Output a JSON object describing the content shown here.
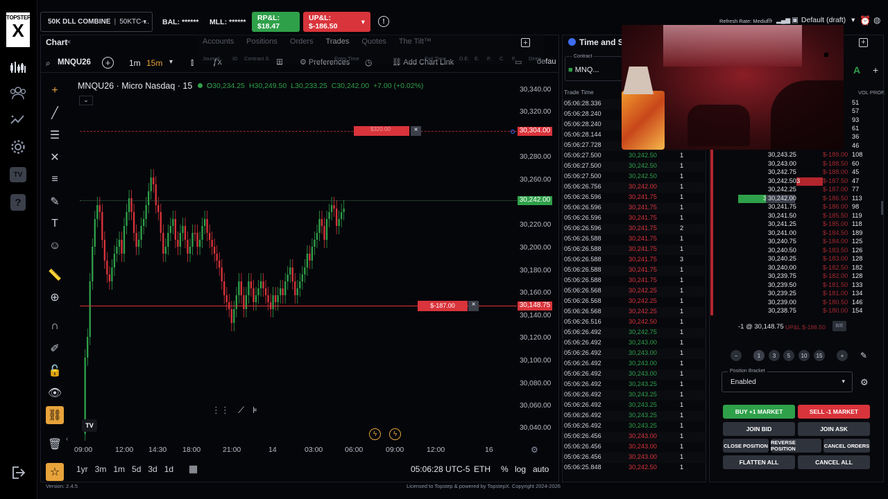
{
  "app": {
    "logo_top": "TOPSTEP",
    "logo_mark": "X",
    "version": "Version: 2.4.5",
    "license": "Licensed to Topstep & powered by TopstepX. Copyright 2024-2026"
  },
  "topbar": {
    "account_name": "50K DLL COMBINE",
    "account_id": "50KTC-...",
    "bal": "BAL: ******",
    "mll": "MLL: ******",
    "rpl": "RP&L: $18.47",
    "upl": "UP&L: $-186.50",
    "refresh": "Refresh Rate: Medium",
    "layout": "Default (draft)"
  },
  "chart_panel": {
    "tab": "Chart",
    "symbol": "MNQU26",
    "interval_1": "1m",
    "interval_2": "15m",
    "preferences": "Preferences",
    "chart_link": "Add Chart Link",
    "default_trunc": "defau",
    "title": "MNQU26 · Micro Nasdaq · 15",
    "ohlc": {
      "o": "O30,234.25",
      "h": "H30,249.50",
      "l": "L30,233.25",
      "c": "C30,242.00",
      "chg": "+7.00 (+0.02%)"
    },
    "price_labels": [
      "30,340.00",
      "30,320.00",
      "30,280.00",
      "30,260.00",
      "30,220.00",
      "30,200.00",
      "30,180.00",
      "30,160.00",
      "30,140.00",
      "30,120.00",
      "30,100.00",
      "30,080.00",
      "30,060.00",
      "30,040.00"
    ],
    "current_price": "30,242.00",
    "target_price": "30,304.00",
    "target_pnl": "$320.00",
    "entry_price": "30,148.75",
    "entry_pnl": "$-187.00",
    "time_labels": [
      "09:00",
      "12:00",
      "14:30",
      "18:00",
      "21:00",
      "14",
      "03:00",
      "06:00",
      "09:00",
      "12:00",
      "16"
    ],
    "clock": "05:06:28 UTC-5",
    "session": "ETH",
    "pct": "%",
    "log": "log",
    "auto": "auto",
    "ranges": [
      "1yr",
      "3m",
      "1m",
      "5d",
      "3d",
      "1d"
    ]
  },
  "overlay_tabs": {
    "tabs": [
      "Accounts",
      "Positions",
      "Orders",
      "Trades",
      "Quotes",
      "The Tilt™"
    ],
    "cols": [
      "Journal",
      "ID",
      "Contract S.",
      "Entry Time",
      "Exit Time",
      "D.E.",
      "E.",
      "P.",
      "C.",
      "F.",
      "Direc"
    ]
  },
  "time_sales": {
    "title": "Time and Sales",
    "contract_label": "Contract",
    "contract": "MNQ...",
    "col_time": "Trade Time",
    "rows": [
      {
        "t": "05:06:28.336",
        "p": "",
        "q": "",
        "c": "w"
      },
      {
        "t": "05:06:28.240",
        "p": "",
        "q": "",
        "c": "w"
      },
      {
        "t": "05:06:28.240",
        "p": "",
        "q": "",
        "c": "w"
      },
      {
        "t": "05:06:28.144",
        "p": "",
        "q": "",
        "c": "w"
      },
      {
        "t": "05:06:27.728",
        "p": "",
        "q": "",
        "c": "w"
      },
      {
        "t": "05:06:27.500",
        "p": "30,242.50",
        "q": "1",
        "c": "g"
      },
      {
        "t": "05:06:27.500",
        "p": "30,242.50",
        "q": "1",
        "c": "g"
      },
      {
        "t": "05:06:27.500",
        "p": "30,242.50",
        "q": "1",
        "c": "g"
      },
      {
        "t": "05:06:26.756",
        "p": "30,242.00",
        "q": "1",
        "c": "r"
      },
      {
        "t": "05:06:26.596",
        "p": "30,241.75",
        "q": "1",
        "c": "r"
      },
      {
        "t": "05:06:26.596",
        "p": "30,241.75",
        "q": "1",
        "c": "r"
      },
      {
        "t": "05:06:26.596",
        "p": "30,241.75",
        "q": "1",
        "c": "r"
      },
      {
        "t": "05:06:26.596",
        "p": "30,241.75",
        "q": "2",
        "c": "r"
      },
      {
        "t": "05:06:26.588",
        "p": "30,241.75",
        "q": "1",
        "c": "r"
      },
      {
        "t": "05:06:26.588",
        "p": "30,241.75",
        "q": "1",
        "c": "r"
      },
      {
        "t": "05:06:26.588",
        "p": "30,241.75",
        "q": "3",
        "c": "r"
      },
      {
        "t": "05:06:26.588",
        "p": "30,241.75",
        "q": "1",
        "c": "r"
      },
      {
        "t": "05:06:26.588",
        "p": "30,241.75",
        "q": "1",
        "c": "r"
      },
      {
        "t": "05:06:26.568",
        "p": "30,242.25",
        "q": "1",
        "c": "r"
      },
      {
        "t": "05:06:26.568",
        "p": "30,242.25",
        "q": "1",
        "c": "r"
      },
      {
        "t": "05:06:26.568",
        "p": "30,242.25",
        "q": "1",
        "c": "r"
      },
      {
        "t": "05:06:26.516",
        "p": "30,242.50",
        "q": "1",
        "c": "r"
      },
      {
        "t": "05:06:26.492",
        "p": "30,242.75",
        "q": "1",
        "c": "g"
      },
      {
        "t": "05:06:26.492",
        "p": "30,243.00",
        "q": "1",
        "c": "g"
      },
      {
        "t": "05:06:26.492",
        "p": "30,243.00",
        "q": "1",
        "c": "g"
      },
      {
        "t": "05:06:26.492",
        "p": "30,243.00",
        "q": "1",
        "c": "g"
      },
      {
        "t": "05:06:26.492",
        "p": "30,243.00",
        "q": "1",
        "c": "g"
      },
      {
        "t": "05:06:26.492",
        "p": "30,243.25",
        "q": "1",
        "c": "g"
      },
      {
        "t": "05:06:26.492",
        "p": "30,243.25",
        "q": "1",
        "c": "g"
      },
      {
        "t": "05:06:26.492",
        "p": "30,243.25",
        "q": "1",
        "c": "g"
      },
      {
        "t": "05:06:26.492",
        "p": "30,243.25",
        "q": "1",
        "c": "g"
      },
      {
        "t": "05:06:26.492",
        "p": "30,243.25",
        "q": "1",
        "c": "g"
      },
      {
        "t": "05:06:26.456",
        "p": "30,243.00",
        "q": "1",
        "c": "r"
      },
      {
        "t": "05:06:26.456",
        "p": "30,243.00",
        "q": "1",
        "c": "r"
      },
      {
        "t": "05:06:26.456",
        "p": "30,243.00",
        "q": "1",
        "c": "r"
      },
      {
        "t": "05:06:25.848",
        "p": "30,242.50",
        "q": "1",
        "c": "r"
      }
    ]
  },
  "dom": {
    "col_vol": "VOL PROF.",
    "top_vols": [
      "51",
      "57",
      "93",
      "61",
      "36",
      "46"
    ],
    "rows": [
      {
        "price": "30,243.25",
        "pnl": "$-189.00",
        "vol": "108"
      },
      {
        "price": "30,243.00",
        "pnl": "$-188.50",
        "vol": "60"
      },
      {
        "price": "30,242.75",
        "pnl": "$-188.00",
        "vol": "45"
      },
      {
        "price": "30,242.50",
        "pnl": "$-187.50",
        "vol": "47",
        "ask": "3"
      },
      {
        "price": "30,242.25",
        "pnl": "$-187.00",
        "vol": "77"
      },
      {
        "price": "30,242.00",
        "pnl": "$-186.50",
        "vol": "113",
        "bid": "3"
      },
      {
        "price": "30,241.75",
        "pnl": "$-186.00",
        "vol": "98"
      },
      {
        "price": "30,241.50",
        "pnl": "$-185.50",
        "vol": "119"
      },
      {
        "price": "30,241.25",
        "pnl": "$-185.00",
        "vol": "118"
      },
      {
        "price": "30,241.00",
        "pnl": "$-184.50",
        "vol": "189"
      },
      {
        "price": "30,240.75",
        "pnl": "$-184.00",
        "vol": "125"
      },
      {
        "price": "30,240.50",
        "pnl": "$-183.50",
        "vol": "126"
      },
      {
        "price": "30,240.25",
        "pnl": "$-183.00",
        "vol": "128"
      },
      {
        "price": "30,240.00",
        "pnl": "$-182.50",
        "vol": "182"
      },
      {
        "price": "30,239.75",
        "pnl": "$-182.00",
        "vol": "128"
      },
      {
        "price": "30,239.50",
        "pnl": "$-181.50",
        "vol": "133"
      },
      {
        "price": "30,239.25",
        "pnl": "$-181.00",
        "vol": "134"
      },
      {
        "price": "30,239.00",
        "pnl": "$-180.50",
        "vol": "146"
      },
      {
        "price": "30,238.75",
        "pnl": "$-180.00",
        "vol": "154"
      }
    ],
    "position": "-1 @ 30,148.75",
    "position_upl": "UP&L $-186.50",
    "be": "B/E"
  },
  "order_panel": {
    "qty": [
      "1",
      "3",
      "5",
      "10",
      "15"
    ],
    "bracket_label": "Position Bracket",
    "bracket_value": "Enabled",
    "buy": "BUY +1 MARKET",
    "sell": "SELL -1 MARKET",
    "join_bid": "JOIN BID",
    "join_ask": "JOIN ASK",
    "close_pos": "CLOSE POSITION",
    "reverse_pos": "REVERSE POSITION",
    "cancel_orders": "CANCEL ORDERS",
    "flatten": "FLATTEN ALL",
    "cancel_all": "CANCEL ALL"
  },
  "colors": {
    "green": "#2fa04a",
    "red": "#d9343b",
    "accent": "#e8a33a",
    "bg": "#05060a"
  }
}
